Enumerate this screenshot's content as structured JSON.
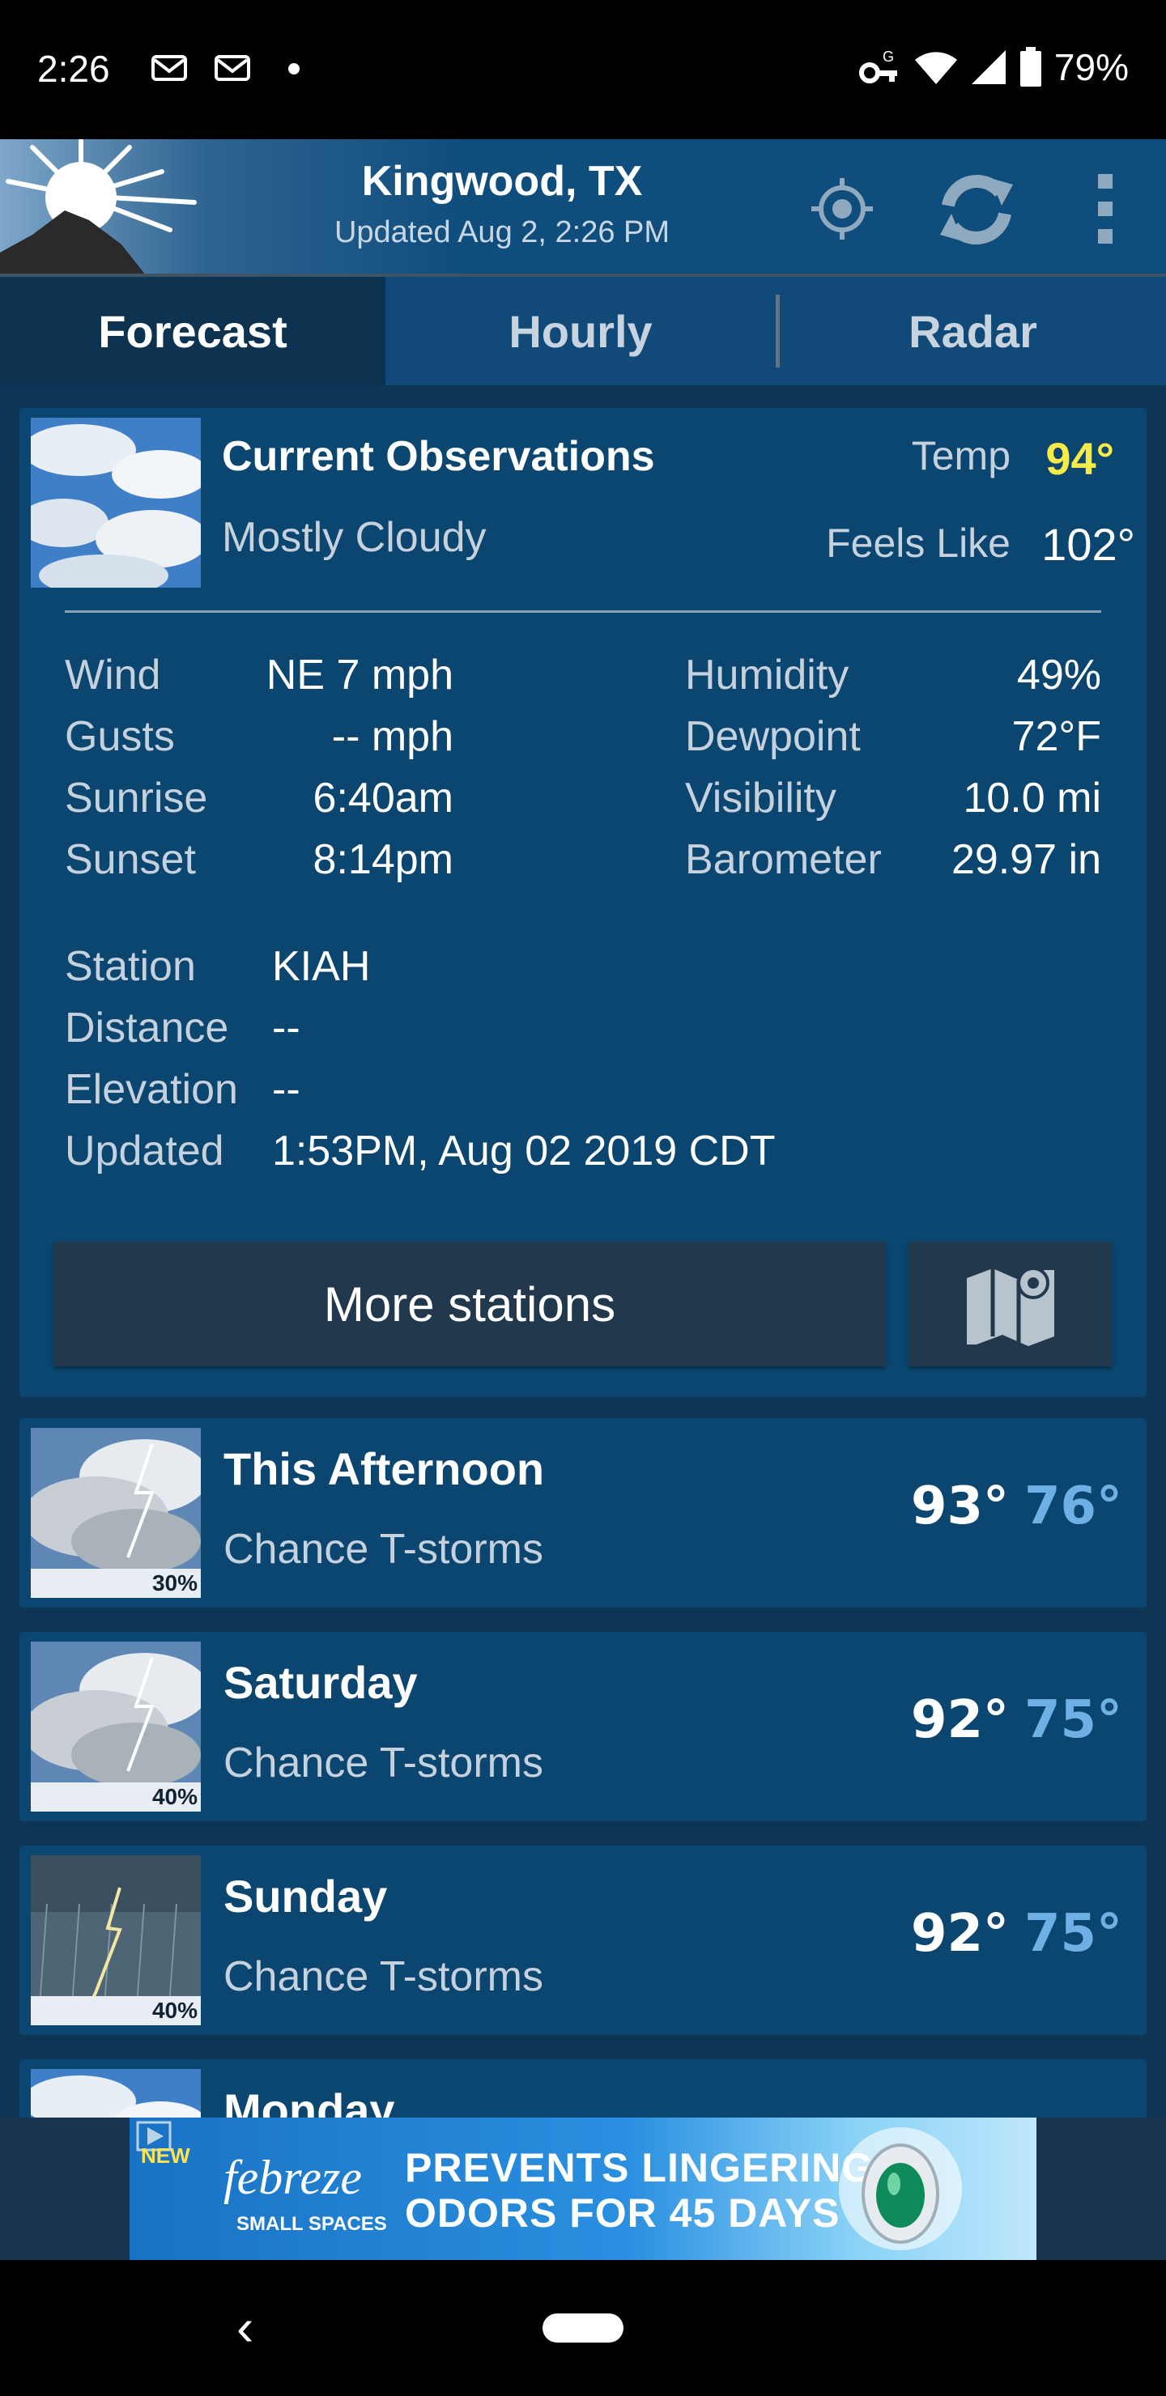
{
  "status_bar": {
    "time": "2:26",
    "battery": "79%",
    "icons": [
      "email-icon",
      "email-icon",
      "dot",
      "vpn-key-icon",
      "wifi-icon",
      "signal-icon",
      "battery-icon"
    ]
  },
  "header": {
    "location": "Kingwood, TX",
    "updated": "Updated Aug 2, 2:26 PM",
    "icons": [
      "locate-icon",
      "refresh-icon",
      "more-vert-icon"
    ]
  },
  "tabs": [
    {
      "label": "Forecast",
      "active": true
    },
    {
      "label": "Hourly",
      "active": false
    },
    {
      "label": "Radar",
      "active": false
    }
  ],
  "current": {
    "title": "Current Observations",
    "condition": "Mostly Cloudy",
    "temp_label": "Temp",
    "temp": "94°",
    "feels_label": "Feels Like",
    "feels": "102°",
    "left": [
      {
        "label": "Wind",
        "value": "NE 7 mph"
      },
      {
        "label": "Gusts",
        "value": "-- mph"
      },
      {
        "label": "Sunrise",
        "value": "6:40am"
      },
      {
        "label": "Sunset",
        "value": "8:14pm"
      }
    ],
    "right": [
      {
        "label": "Humidity",
        "value": "49%"
      },
      {
        "label": "Dewpoint",
        "value": "72°F"
      },
      {
        "label": "Visibility",
        "value": "10.0 mi"
      },
      {
        "label": "Barometer",
        "value": "29.97 in"
      }
    ],
    "station": [
      {
        "label": "Station",
        "value": "KIAH"
      },
      {
        "label": "Distance",
        "value": "--"
      },
      {
        "label": "Elevation",
        "value": "--"
      },
      {
        "label": "Updated",
        "value": "1:53PM, Aug 02 2019 CDT"
      }
    ],
    "more_button": "More stations"
  },
  "forecast": [
    {
      "day": "This Afternoon",
      "condition": "Chance T-storms",
      "hi": "93°",
      "lo": "76°",
      "pop": "30%"
    },
    {
      "day": "Saturday",
      "condition": "Chance T-storms",
      "hi": "92°",
      "lo": "75°",
      "pop": "40%"
    },
    {
      "day": "Sunday",
      "condition": "Chance T-storms",
      "hi": "92°",
      "lo": "75°",
      "pop": "40%"
    },
    {
      "day": "Monday",
      "condition": "",
      "hi": "",
      "lo": "",
      "pop": ""
    }
  ],
  "ad": {
    "badge": "NEW",
    "brand": "febreze",
    "brand_sub": "SMALL SPACES",
    "headline_1": "PREVENTS LINGERING",
    "headline_2": "ODORS FOR 45 DAYS"
  },
  "colors": {
    "background": "#0e3553",
    "card": "#0b4670",
    "temp_highlight": "#f7ec47",
    "low_temp": "#6fb0e4"
  }
}
